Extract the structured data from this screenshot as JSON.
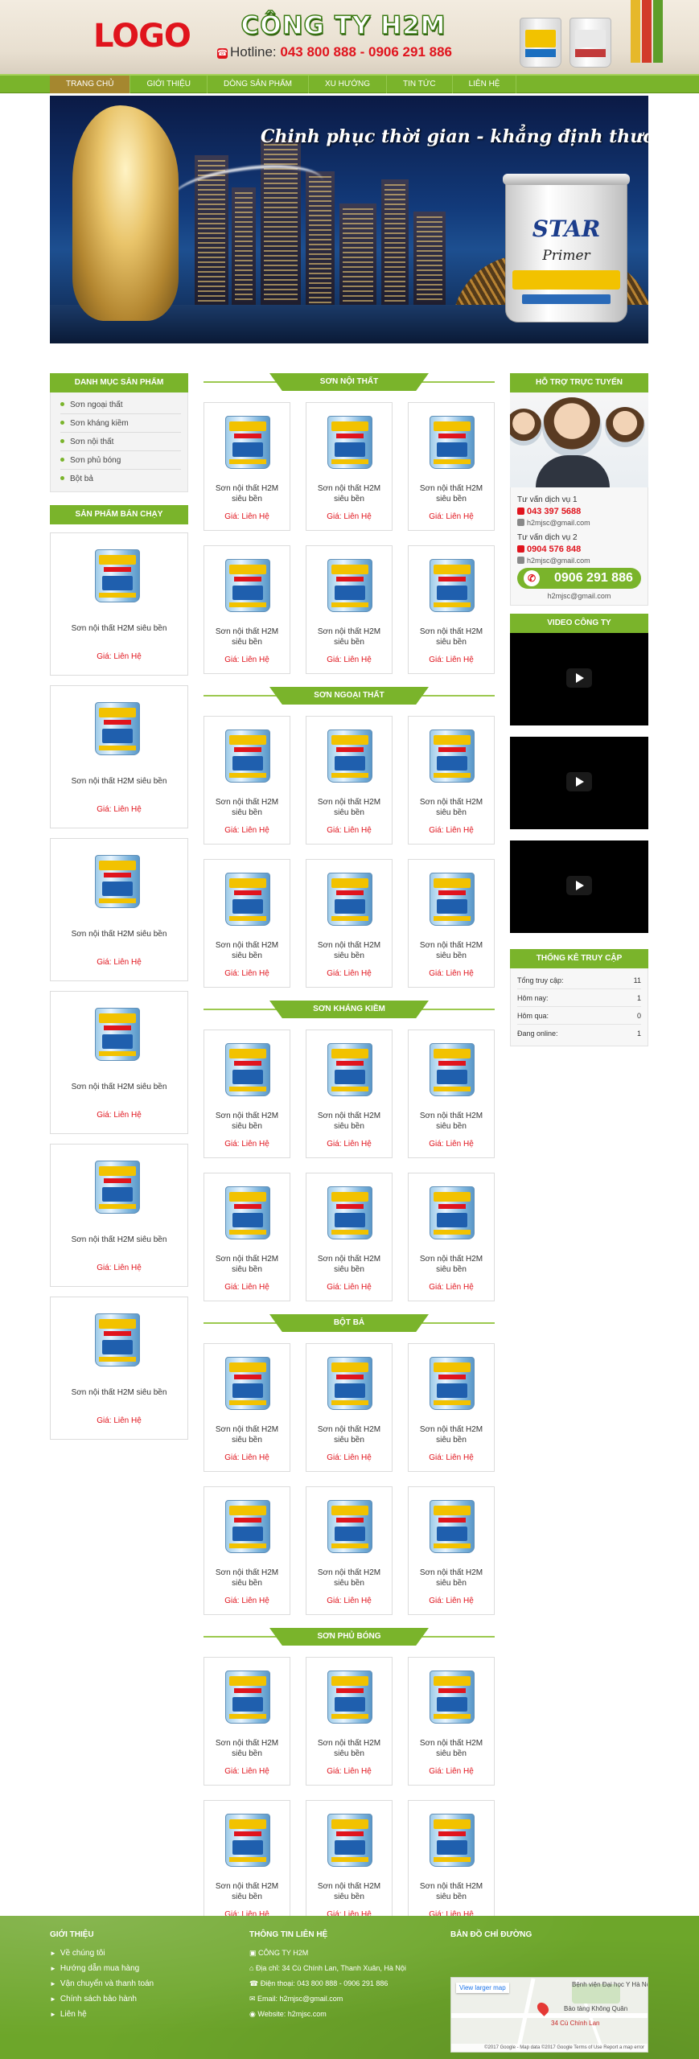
{
  "header": {
    "logo": "LOGO",
    "company": "CÔNG TY H2M",
    "hotline_label": "Hotline:",
    "hotline_numbers": "043 800 888 - 0906 291 886"
  },
  "nav": {
    "items": [
      "TRANG CHỦ",
      "GIỚI THIỆU",
      "DÒNG SẢN PHẨM",
      "XU HƯỚNG",
      "TIN TỨC",
      "LIÊN HỆ"
    ]
  },
  "banner": {
    "slogan": "Chinh phục thời gian - khẳng định thương hiệu",
    "bucket_brand": "STAR",
    "bucket_product": "Primer"
  },
  "left": {
    "category_title": "DANH MỤC SẢN PHẨM",
    "categories": [
      "Sơn ngoại thất",
      "Sơn kháng kiềm",
      "Sơn nội thất",
      "Sơn phủ bóng",
      "Bột bả"
    ],
    "bestseller_title": "SẢN PHẨM BÁN CHẠY",
    "bestsellers": [
      {
        "name": "Sơn nội thất H2M siêu bền",
        "price": "Giá: Liên Hệ"
      },
      {
        "name": "Sơn nội thất H2M siêu bền",
        "price": "Giá: Liên Hệ"
      },
      {
        "name": "Sơn nội thất H2M siêu bền",
        "price": "Giá: Liên Hệ"
      },
      {
        "name": "Sơn nội thất H2M siêu bền",
        "price": "Giá: Liên Hệ"
      },
      {
        "name": "Sơn nội thất H2M siêu bền",
        "price": "Giá: Liên Hệ"
      },
      {
        "name": "Sơn nội thất H2M siêu bền",
        "price": "Giá: Liên Hệ"
      }
    ]
  },
  "sections": [
    {
      "title": "SƠN NỘI THẤT"
    },
    {
      "title": "SƠN NGOẠI THẤT"
    },
    {
      "title": "SƠN KHÁNG KIỀM"
    },
    {
      "title": "BỘT BẢ"
    },
    {
      "title": "SƠN PHỦ BÓNG"
    }
  ],
  "product": {
    "name": "Sơn nội thất H2M siêu bền",
    "price": "Giá: Liên Hệ"
  },
  "right": {
    "support_title": "HỖ TRỢ TRỰC TUYẾN",
    "support": [
      {
        "title": "Tư vấn dịch vụ 1",
        "phone": "043 397 5688",
        "email": "h2mjsc@gmail.com"
      },
      {
        "title": "Tư vấn dịch vụ 2",
        "phone": "0904 576 848",
        "email": "h2mjsc@gmail.com"
      }
    ],
    "hotline": "0906 291 886",
    "hotline_email": "h2mjsc@gmail.com",
    "video_title": "VIDEO CÔNG TY",
    "stats_title": "THỐNG KÊ TRUY CẬP",
    "stats": [
      {
        "label": "Tổng truy cập:",
        "value": "11"
      },
      {
        "label": "Hôm nay:",
        "value": "1"
      },
      {
        "label": "Hôm qua:",
        "value": "0"
      },
      {
        "label": "Đang online:",
        "value": "1"
      }
    ]
  },
  "footer": {
    "about_title": "GIỚI THIỆU",
    "about_links": [
      "Về chúng tôi",
      "Hướng dẫn mua hàng",
      "Vận chuyển và thanh toán",
      "Chính sách bảo hành",
      "Liên hệ"
    ],
    "contact_title": "THÔNG TIN LIÊN HỆ",
    "contact": {
      "company": "CÔNG TY H2M",
      "address": "Địa chỉ: 34 Cù Chính Lan, Thanh Xuân, Hà Nội",
      "phone": "Điện thoại: 043 800 888 - 0906 291 886",
      "email": "Email: h2mjsc@gmail.com",
      "website": "Website: h2mjsc.com"
    },
    "map_title": "BẢN ĐỒ CHỈ ĐƯỜNG",
    "map": {
      "larger_link": "View larger map",
      "pin_label": "34 Cù Chính Lan",
      "place1": "Bệnh viện Đại học Y Hà Nội",
      "place2": "Bảo tàng Không Quân",
      "attribution": "©2017 Google - Map data ©2017 Google  Terms of Use  Report a map error"
    }
  },
  "colors": {
    "accent_green": "#7ab42b",
    "price_red": "#e0141d",
    "nav_active": "#a5872f"
  }
}
